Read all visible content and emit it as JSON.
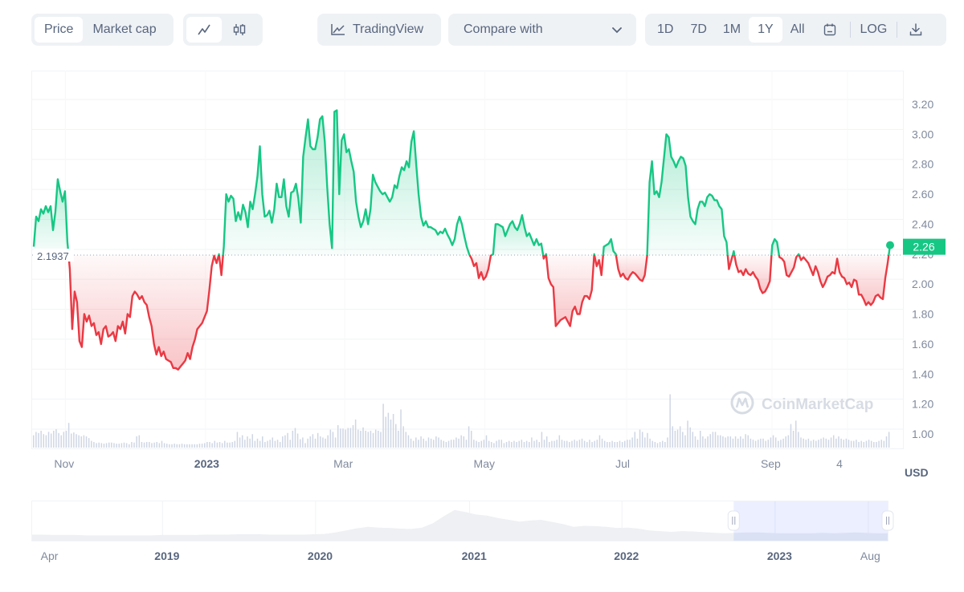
{
  "toolbar": {
    "metric_tabs": [
      {
        "label": "Price",
        "active": true
      },
      {
        "label": "Market cap",
        "active": false
      }
    ],
    "chart_type_tabs": [
      {
        "icon": "line-chart-icon",
        "active": true
      },
      {
        "icon": "candlestick-icon",
        "active": false
      }
    ],
    "tradingview_label": "TradingView",
    "compare_label": "Compare with",
    "range_tabs": [
      {
        "label": "1D",
        "active": false
      },
      {
        "label": "7D",
        "active": false
      },
      {
        "label": "1M",
        "active": false
      },
      {
        "label": "1Y",
        "active": true
      },
      {
        "label": "All",
        "active": false
      }
    ],
    "calendar_icon": "calendar-icon",
    "log_label": "LOG",
    "download_icon": "download-icon"
  },
  "colors": {
    "up": "#16c784",
    "down": "#ea3943",
    "badge": "#16c784",
    "volume": "#cfd6e4",
    "navigator_selection": "#e8eefc"
  },
  "watermark": "CoinMarketCap",
  "currency_label": "USD",
  "chart_data": {
    "type": "line",
    "title": "",
    "xlabel": "",
    "ylabel": "USD",
    "ylim": [
      0.9,
      3.3
    ],
    "yticks": [
      "3.20",
      "3.00",
      "2.80",
      "2.60",
      "2.40",
      "2.20",
      "2.00",
      "1.80",
      "1.60",
      "1.40",
      "1.20",
      "1.00"
    ],
    "xticks": [
      {
        "label": "Nov",
        "bold": false,
        "pos": 0.02
      },
      {
        "label": "2023",
        "bold": true,
        "pos": 0.183
      },
      {
        "label": "Mar",
        "bold": false,
        "pos": 0.345
      },
      {
        "label": "May",
        "bold": false,
        "pos": 0.508
      },
      {
        "label": "Jul",
        "bold": false,
        "pos": 0.673
      },
      {
        "label": "Sep",
        "bold": false,
        "pos": 0.842
      },
      {
        "label": "4",
        "bold": false,
        "pos": 0.93
      }
    ],
    "baseline": 2.1937,
    "baseline_label": "2.1937",
    "current_value": 2.26,
    "current_label": "2.26",
    "grid": true,
    "series": [
      {
        "name": "Price",
        "values": [
          2.25,
          2.45,
          2.42,
          2.5,
          2.47,
          2.52,
          2.48,
          2.52,
          2.36,
          2.48,
          2.7,
          2.62,
          2.55,
          2.62,
          2.28,
          2.1,
          1.7,
          1.95,
          1.88,
          1.62,
          1.58,
          1.8,
          1.75,
          1.79,
          1.72,
          1.74,
          1.66,
          1.68,
          1.6,
          1.7,
          1.72,
          1.65,
          1.66,
          1.68,
          1.62,
          1.72,
          1.7,
          1.75,
          1.67,
          1.8,
          1.78,
          1.92,
          1.95,
          1.93,
          1.9,
          1.92,
          1.88,
          1.86,
          1.78,
          1.72,
          1.6,
          1.53,
          1.58,
          1.52,
          1.55,
          1.5,
          1.49,
          1.48,
          1.44,
          1.44,
          1.43,
          1.45,
          1.47,
          1.49,
          1.54,
          1.5,
          1.58,
          1.63,
          1.7,
          1.72,
          1.74,
          1.78,
          1.82,
          1.96,
          2.12,
          2.19,
          2.14,
          2.2,
          2.06,
          2.25,
          2.6,
          2.55,
          2.59,
          2.57,
          2.42,
          2.48,
          2.43,
          2.53,
          2.48,
          2.38,
          2.55,
          2.5,
          2.6,
          2.72,
          2.92,
          2.6,
          2.45,
          2.46,
          2.49,
          2.41,
          2.5,
          2.67,
          2.58,
          2.58,
          2.7,
          2.52,
          2.45,
          2.61,
          2.62,
          2.67,
          2.57,
          2.41,
          2.85,
          2.98,
          3.1,
          2.92,
          2.9,
          2.9,
          2.98,
          3.1,
          3.12,
          2.95,
          2.65,
          2.4,
          2.24,
          3.15,
          3.16,
          2.6,
          2.96,
          3.0,
          2.88,
          2.9,
          2.82,
          2.75,
          2.55,
          2.45,
          2.38,
          2.42,
          2.5,
          2.4,
          2.5,
          2.73,
          2.68,
          2.65,
          2.62,
          2.6,
          2.61,
          2.58,
          2.55,
          2.58,
          2.66,
          2.64,
          2.72,
          2.78,
          2.76,
          2.82,
          2.78,
          2.95,
          3.02,
          2.8,
          2.6,
          2.45,
          2.39,
          2.42,
          2.38,
          2.38,
          2.37,
          2.36,
          2.33,
          2.35,
          2.34,
          2.37,
          2.33,
          2.3,
          2.26,
          2.3,
          2.4,
          2.45,
          2.4,
          2.32,
          2.25,
          2.2,
          2.17,
          2.12,
          2.14,
          2.04,
          2.08,
          2.03,
          2.05,
          2.1,
          2.19,
          2.2,
          2.4,
          2.4,
          2.39,
          2.38,
          2.32,
          2.36,
          2.4,
          2.42,
          2.38,
          2.36,
          2.4,
          2.46,
          2.38,
          2.32,
          2.34,
          2.3,
          2.26,
          2.3,
          2.26,
          2.27,
          2.17,
          2.2,
          2.04,
          2.0,
          1.98,
          1.72,
          1.74,
          1.76,
          1.77,
          1.78,
          1.75,
          1.72,
          1.82,
          1.85,
          1.8,
          1.8,
          1.88,
          1.92,
          1.92,
          1.9,
          1.96,
          2.2,
          2.12,
          2.16,
          2.06,
          2.25,
          2.26,
          2.27,
          2.3,
          2.22,
          2.2,
          2.1,
          2.05,
          2.07,
          2.04,
          2.03,
          2.06,
          2.08,
          2.07,
          2.05,
          2.03,
          2.02,
          2.06,
          2.19,
          2.68,
          2.82,
          2.6,
          2.62,
          2.58,
          2.68,
          2.84,
          3.0,
          2.98,
          2.85,
          2.82,
          2.78,
          2.82,
          2.85,
          2.84,
          2.79,
          2.58,
          2.45,
          2.42,
          2.4,
          2.5,
          2.55,
          2.55,
          2.52,
          2.58,
          2.6,
          2.59,
          2.56,
          2.56,
          2.52,
          2.5,
          2.32,
          2.28,
          2.1,
          2.16,
          2.22,
          2.13,
          2.08,
          2.09,
          2.06,
          2.1,
          2.07,
          2.06,
          2.08,
          2.05,
          2.03,
          1.97,
          1.94,
          1.95,
          1.98,
          2.02,
          2.26,
          2.3,
          2.28,
          2.18,
          2.17,
          2.15,
          2.06,
          2.05,
          2.08,
          2.11,
          2.18,
          2.2,
          2.16,
          2.18,
          2.16,
          2.14,
          2.1,
          2.06,
          2.12,
          2.08,
          2.02,
          1.98,
          2.01,
          2.05,
          2.06,
          2.08,
          2.07,
          2.17,
          2.08,
          2.05,
          2.04,
          2.0,
          2.01,
          1.98,
          2.03,
          2.02,
          1.93,
          1.93,
          1.9,
          1.86,
          1.88,
          1.86,
          1.88,
          1.92,
          1.93,
          1.91,
          1.9,
          2.04,
          2.14,
          2.26
        ]
      }
    ],
    "volume": [
      0.22,
      0.28,
      0.26,
      0.3,
      0.24,
      0.22,
      0.28,
      0.25,
      0.3,
      0.33,
      0.26,
      0.22,
      0.28,
      0.3,
      0.44,
      0.25,
      0.27,
      0.24,
      0.22,
      0.2,
      0.22,
      0.2,
      0.17,
      0.12,
      0.1,
      0.08,
      0.09,
      0.08,
      0.07,
      0.08,
      0.09,
      0.09,
      0.08,
      0.07,
      0.07,
      0.08,
      0.09,
      0.08,
      0.06,
      0.1,
      0.09,
      0.2,
      0.22,
      0.1,
      0.09,
      0.1,
      0.1,
      0.08,
      0.09,
      0.1,
      0.08,
      0.12,
      0.08,
      0.07,
      0.06,
      0.06,
      0.07,
      0.06,
      0.06,
      0.07,
      0.06,
      0.06,
      0.06,
      0.06,
      0.06,
      0.06,
      0.07,
      0.07,
      0.08,
      0.1,
      0.1,
      0.08,
      0.12,
      0.09,
      0.1,
      0.08,
      0.12,
      0.09,
      0.09,
      0.1,
      0.12,
      0.28,
      0.18,
      0.22,
      0.14,
      0.2,
      0.16,
      0.24,
      0.12,
      0.16,
      0.12,
      0.2,
      0.1,
      0.12,
      0.14,
      0.18,
      0.12,
      0.14,
      0.1,
      0.2,
      0.22,
      0.26,
      0.14,
      0.3,
      0.35,
      0.25,
      0.15,
      0.18,
      0.08,
      0.16,
      0.2,
      0.24,
      0.16,
      0.26,
      0.2,
      0.18,
      0.16,
      0.22,
      0.32,
      0.28,
      0.18,
      0.4,
      0.34,
      0.34,
      0.32,
      0.35,
      0.35,
      0.4,
      0.5,
      0.32,
      0.3,
      0.36,
      0.3,
      0.28,
      0.3,
      0.26,
      0.32,
      0.3,
      0.28,
      0.78,
      0.55,
      0.62,
      0.5,
      0.6,
      0.42,
      0.3,
      0.68,
      0.38,
      0.28,
      0.22,
      0.16,
      0.12,
      0.18,
      0.14,
      0.2,
      0.16,
      0.12,
      0.18,
      0.16,
      0.14,
      0.2,
      0.18,
      0.14,
      0.12,
      0.1,
      0.12,
      0.14,
      0.14,
      0.18,
      0.16,
      0.22,
      0.2,
      0.14,
      0.38,
      0.3,
      0.14,
      0.12,
      0.1,
      0.12,
      0.14,
      0.22,
      0.12,
      0.1,
      0.08,
      0.12,
      0.14,
      0.14,
      0.08,
      0.1,
      0.12,
      0.1,
      0.12,
      0.1,
      0.12,
      0.14,
      0.1,
      0.12,
      0.1,
      0.18,
      0.12,
      0.14,
      0.1,
      0.28,
      0.14,
      0.2,
      0.1,
      0.12,
      0.12,
      0.14,
      0.22,
      0.14,
      0.12,
      0.12,
      0.1,
      0.12,
      0.14,
      0.12,
      0.14,
      0.16,
      0.12,
      0.1,
      0.14,
      0.1,
      0.12,
      0.14,
      0.22,
      0.16,
      0.12,
      0.1,
      0.1,
      0.12,
      0.1,
      0.1,
      0.12,
      0.1,
      0.12,
      0.14,
      0.14,
      0.18,
      0.28,
      0.16,
      0.32,
      0.28,
      0.18,
      0.26,
      0.16,
      0.12,
      0.1,
      0.08,
      0.1,
      0.12,
      0.1,
      0.18,
      0.95,
      0.38,
      0.3,
      0.32,
      0.38,
      0.28,
      0.22,
      0.48,
      0.36,
      0.28,
      0.2,
      0.14,
      0.3,
      0.2,
      0.16,
      0.2,
      0.24,
      0.28,
      0.28,
      0.22,
      0.22,
      0.2,
      0.18,
      0.2,
      0.2,
      0.16,
      0.2,
      0.16,
      0.2,
      0.16,
      0.24,
      0.22,
      0.16,
      0.14,
      0.12,
      0.14,
      0.16,
      0.16,
      0.12,
      0.14,
      0.18,
      0.22,
      0.18,
      0.12,
      0.14,
      0.16,
      0.2,
      0.22,
      0.42,
      0.3,
      0.48,
      0.28,
      0.18,
      0.16,
      0.14,
      0.16,
      0.12,
      0.14,
      0.12,
      0.14,
      0.16,
      0.18,
      0.16,
      0.14,
      0.18,
      0.22,
      0.16,
      0.2,
      0.16,
      0.14,
      0.16,
      0.14,
      0.12,
      0.12,
      0.14,
      0.1,
      0.12,
      0.1,
      0.12,
      0.14,
      0.12,
      0.1,
      0.1,
      0.12,
      0.14,
      0.12,
      0.2,
      0.28
    ]
  },
  "navigator": {
    "xticks": [
      {
        "label": "Apr",
        "bold": false,
        "pos": 0.01
      },
      {
        "label": "2019",
        "bold": true,
        "pos": 0.143
      },
      {
        "label": "2020",
        "bold": true,
        "pos": 0.322
      },
      {
        "label": "2021",
        "bold": true,
        "pos": 0.502
      },
      {
        "label": "2022",
        "bold": true,
        "pos": 0.68
      },
      {
        "label": "2023",
        "bold": true,
        "pos": 0.859
      },
      {
        "label": "Aug",
        "bold": false,
        "pos": 0.968
      }
    ],
    "selection_start": 0.82,
    "selection_end": 1.0,
    "history": [
      0.08,
      0.08,
      0.07,
      0.07,
      0.07,
      0.06,
      0.06,
      0.06,
      0.06,
      0.06,
      0.06,
      0.06,
      0.07,
      0.07,
      0.07,
      0.07,
      0.08,
      0.08,
      0.08,
      0.09,
      0.09,
      0.09,
      0.08,
      0.08,
      0.08,
      0.08,
      0.09,
      0.1,
      0.14,
      0.2,
      0.26,
      0.3,
      0.28,
      0.27,
      0.25,
      0.24,
      0.28,
      0.4,
      0.6,
      0.78,
      0.72,
      0.65,
      0.62,
      0.55,
      0.5,
      0.45,
      0.48,
      0.5,
      0.44,
      0.38,
      0.3,
      0.33,
      0.32,
      0.3,
      0.27,
      0.28,
      0.25,
      0.2,
      0.18,
      0.16,
      0.18,
      0.17,
      0.15,
      0.13,
      0.12,
      0.13,
      0.14,
      0.14,
      0.13,
      0.12,
      0.12,
      0.12,
      0.12,
      0.13,
      0.12,
      0.13,
      0.14,
      0.13,
      0.12,
      0.12
    ]
  }
}
